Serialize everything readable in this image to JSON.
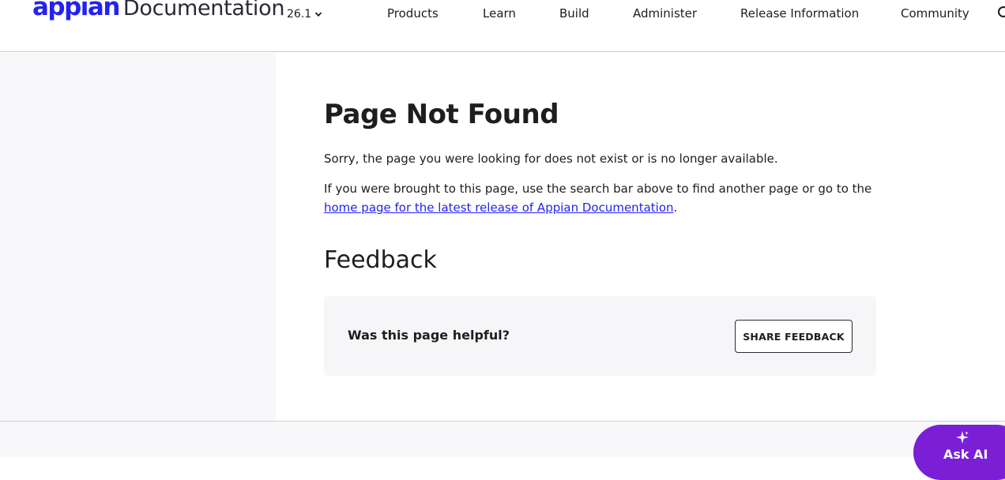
{
  "header": {
    "logo_brand": "appian",
    "logo_suffix": "Documentation",
    "version": "26.1",
    "nav": [
      {
        "label": "Products"
      },
      {
        "label": "Learn"
      },
      {
        "label": "Build"
      },
      {
        "label": "Administer"
      },
      {
        "label": "Release Information"
      },
      {
        "label": "Community"
      }
    ]
  },
  "main": {
    "title": "Page Not Found",
    "message": "Sorry, the page you were looking for does not exist or is no longer available.",
    "hint_text": "If you were brought to this page, use the search bar above to find another page or go to the",
    "hint_link": "home page for the latest release of Appian Documentation",
    "hint_end": "."
  },
  "feedback": {
    "title": "Feedback",
    "question": "Was this page helpful?",
    "button_label": "SHARE FEEDBACK"
  },
  "ask_ai": {
    "label": "Ask AI"
  },
  "icons": {
    "version_chevron": "chevron-down-icon",
    "search": "search-icon",
    "ask_ai": "sparkle-icon"
  },
  "colors": {
    "brand": "#2322f0",
    "ask_ai_bg": "#7a1fd6",
    "sidebar_bg": "#f8f8fa",
    "card_bg": "#f6f6f9"
  }
}
